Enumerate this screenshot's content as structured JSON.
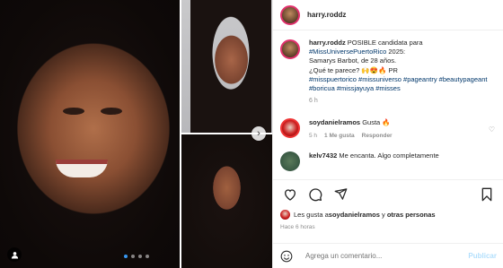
{
  "post": {
    "username": "harry.roddz",
    "caption_user": "harry.roddz",
    "caption_text": "POSIBLE candidata para",
    "caption_tag1": "#MissUniversePuertoRico",
    "caption_tag1_tail": " 2025:",
    "caption_line2": "Samarys Barbot, de 28 años.",
    "caption_line3": "¿Qué te parece? 🙌😍🔥 PR",
    "caption_tags": "#misspuertorico #missuniverso #pageantry #beautypageant #boricua #missjayuya #misses",
    "caption_time": "6 h"
  },
  "comments": [
    {
      "user": "soydanielramos",
      "text": "Gusta 🔥",
      "time": "5 h",
      "likes": "1 Me gusta",
      "reply": "Responder"
    },
    {
      "user": "kelv7432",
      "text": "Me encanta. Algo completamente"
    }
  ],
  "likes": {
    "prefix": "Les gusta a ",
    "user": "soydanielramos",
    "middle": " y ",
    "others": "otras personas"
  },
  "timestamp": "Hace 6 horas",
  "add_comment": {
    "placeholder": "Agrega un comentario...",
    "post_label": "Publicar"
  },
  "carousel": {
    "current": 1,
    "total": 4
  },
  "colors": {
    "accent": "#3897f0",
    "link": "#00376b",
    "muted": "#8e8e8e"
  }
}
